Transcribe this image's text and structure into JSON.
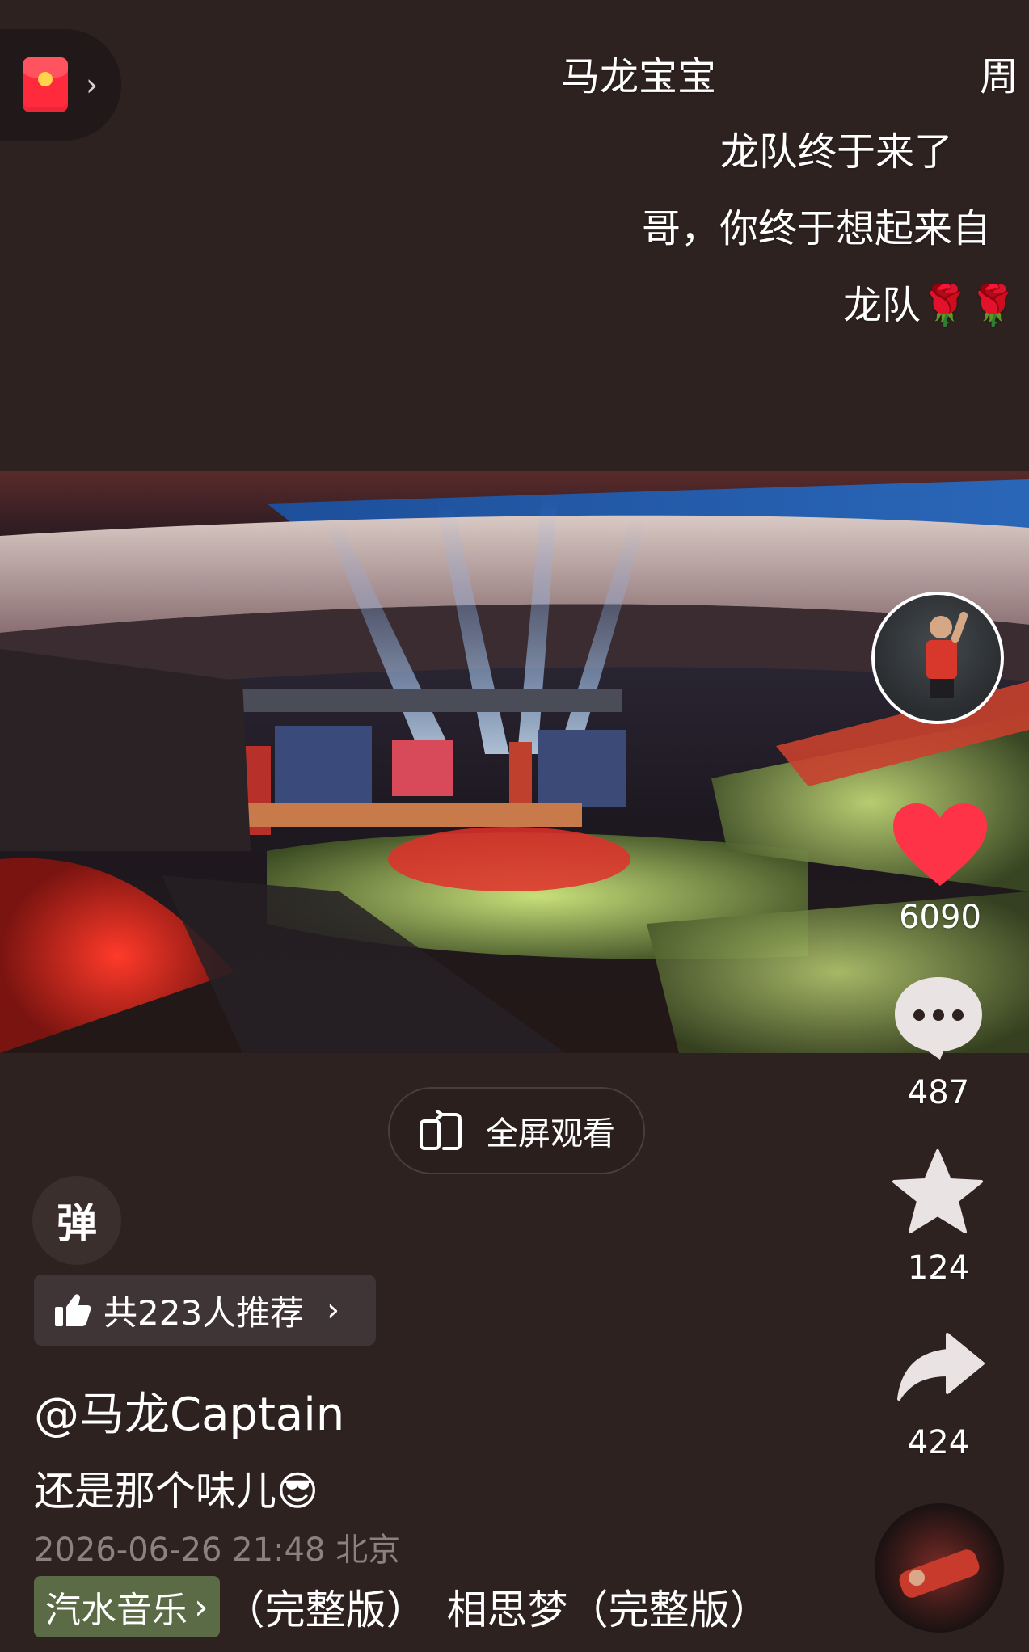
{
  "danmaku": [
    {
      "text": "马龙宝宝"
    },
    {
      "text": "周"
    },
    {
      "text": "龙队终于来了"
    },
    {
      "text": "哥，你终于想起来自"
    },
    {
      "text": "龙队🌹🌹"
    }
  ],
  "actions": {
    "like_count": "6090",
    "comment_count": "487",
    "favorite_count": "124",
    "share_count": "424"
  },
  "fullscreen": {
    "label": "全屏观看"
  },
  "danmaku_toggle": {
    "label": "弹"
  },
  "recommend": {
    "label": "共223人推荐"
  },
  "post": {
    "author": "@马龙Captain",
    "caption": "还是那个味儿😎",
    "timestamp": "2026-06-26 21:48 北京"
  },
  "music": {
    "badge": "汽水音乐",
    "title": "（完整版）　相思梦（完整版）"
  },
  "colors": {
    "background": "#2e2220",
    "like": "#ff3347",
    "music_badge": "#5b6b45",
    "redpacket": "#ff2b3c"
  }
}
